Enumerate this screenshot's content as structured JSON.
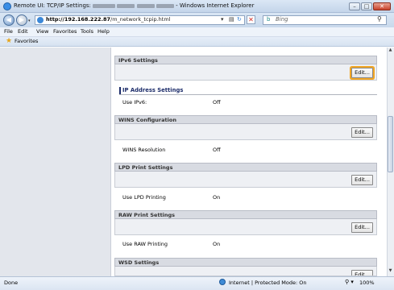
{
  "window": {
    "title_prefix": "Remote UI: TCP/IP Settings:",
    "title_suffix": "- Windows Internet Explorer",
    "min_glyph": "–",
    "max_glyph": "□",
    "close_glyph": "✕"
  },
  "address_bar": {
    "url_host": "http://192.168.222.87",
    "url_path": "/m_network_tcpip.html",
    "search_placeholder": "Bing",
    "back_glyph": "◀",
    "forward_glyph": "▶",
    "drop_glyph": "▾",
    "compat_glyph": "▤",
    "refresh_glyph": "↻",
    "stop_glyph": "✕",
    "search_glyph": "⚲",
    "bing_glyph": "b"
  },
  "menu": [
    "File",
    "Edit",
    "View",
    "Favorites",
    "Tools",
    "Help"
  ],
  "favorites_label": "Favorites",
  "edit_label": "Edit...",
  "sections": {
    "ipv6": {
      "title": "IPv6 Settings"
    },
    "ip_address": {
      "title": "IP Address Settings",
      "label": "Use IPv6:",
      "value": "Off"
    },
    "wins": {
      "title": "WINS Configuration",
      "label": "WINS Resolution",
      "value": "Off"
    },
    "lpd": {
      "title": "LPD Print Settings",
      "label": "Use LPD Printing",
      "value": "On"
    },
    "raw": {
      "title": "RAW Print Settings",
      "label": "Use RAW Printing",
      "value": "On"
    },
    "wsd": {
      "title": "WSD Settings"
    }
  },
  "status": {
    "text": "Done",
    "zone": "Internet | Protected Mode: On",
    "zoom": "100%",
    "zoom_glyph": "⚲ ▾"
  },
  "colors": {
    "accent_highlight": "#f2a623",
    "section_header_bg": "#d8dbe2",
    "ip_title": "#1c2c6a"
  },
  "icons": [
    "ie-icon",
    "back-icon",
    "forward-icon",
    "refresh-icon",
    "stop-icon",
    "search-icon",
    "favorites-star-icon",
    "globe-icon",
    "zoom-icon"
  ]
}
